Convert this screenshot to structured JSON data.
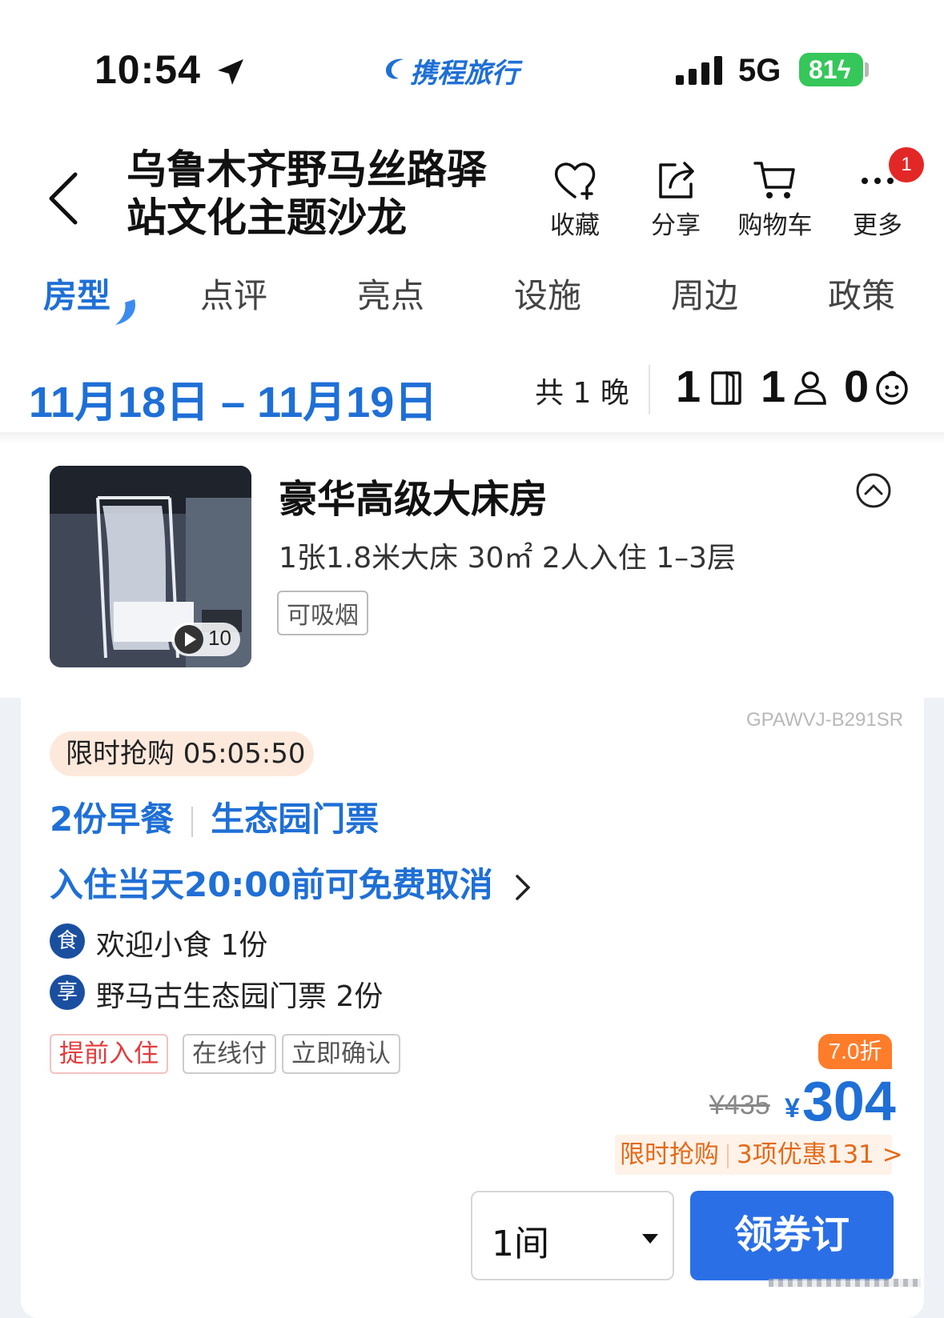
{
  "status_bar": {
    "time": "10:54",
    "brand": "携程旅行",
    "network": "5G",
    "battery": "81"
  },
  "header": {
    "title": "乌鲁木齐野马丝路驿站文化主题沙龙",
    "actions": [
      {
        "label": "收藏",
        "icon": "heart-icon"
      },
      {
        "label": "分享",
        "icon": "share-icon"
      },
      {
        "label": "购物车",
        "icon": "cart-icon"
      },
      {
        "label": "更多",
        "icon": "more-icon"
      }
    ],
    "more_badge": "1"
  },
  "tabs": [
    {
      "label": "房型",
      "active": true
    },
    {
      "label": "点评",
      "active": false
    },
    {
      "label": "亮点",
      "active": false
    },
    {
      "label": "设施",
      "active": false
    },
    {
      "label": "周边",
      "active": false
    },
    {
      "label": "政策",
      "active": false
    }
  ],
  "dates": {
    "range": "11月18日 – 11月19日",
    "nights": "共 1 晚",
    "rooms": "1",
    "adults": "1",
    "children": "0"
  },
  "room": {
    "name": "豪华高级大床房",
    "spec": "1张1.8米大床  30㎡  2人入住  1–3层",
    "tag": "可吸烟",
    "media_count": "10"
  },
  "offer": {
    "code": "GPAWVJ-B291SR",
    "flash_sale": "限时抢购 05:05:50",
    "perks": [
      "2份早餐",
      "生态园门票"
    ],
    "cancel_policy": "入住当天20:00前可免费取消",
    "gifts": [
      {
        "icon_text": "食",
        "text": "欢迎小食 1份"
      },
      {
        "icon_text": "享",
        "text": "野马古生态园门票 2份"
      }
    ],
    "tags": [
      {
        "label": "提前入住",
        "style": "red"
      },
      {
        "label": "在线付",
        "style": "grey"
      },
      {
        "label": "立即确认",
        "style": "grey"
      }
    ],
    "discount": "7.0折",
    "original_price": "¥435",
    "currency": "¥",
    "price": "304",
    "promo_label": "限时抢购",
    "promo_detail": "3项优惠131 >",
    "quantity": "1间",
    "book_button": "领券订"
  },
  "colors": {
    "brand_blue": "#1f6fd6",
    "button_blue": "#2b6fe6",
    "accent_orange": "#ff7c2a",
    "badge_red": "#e32727"
  }
}
